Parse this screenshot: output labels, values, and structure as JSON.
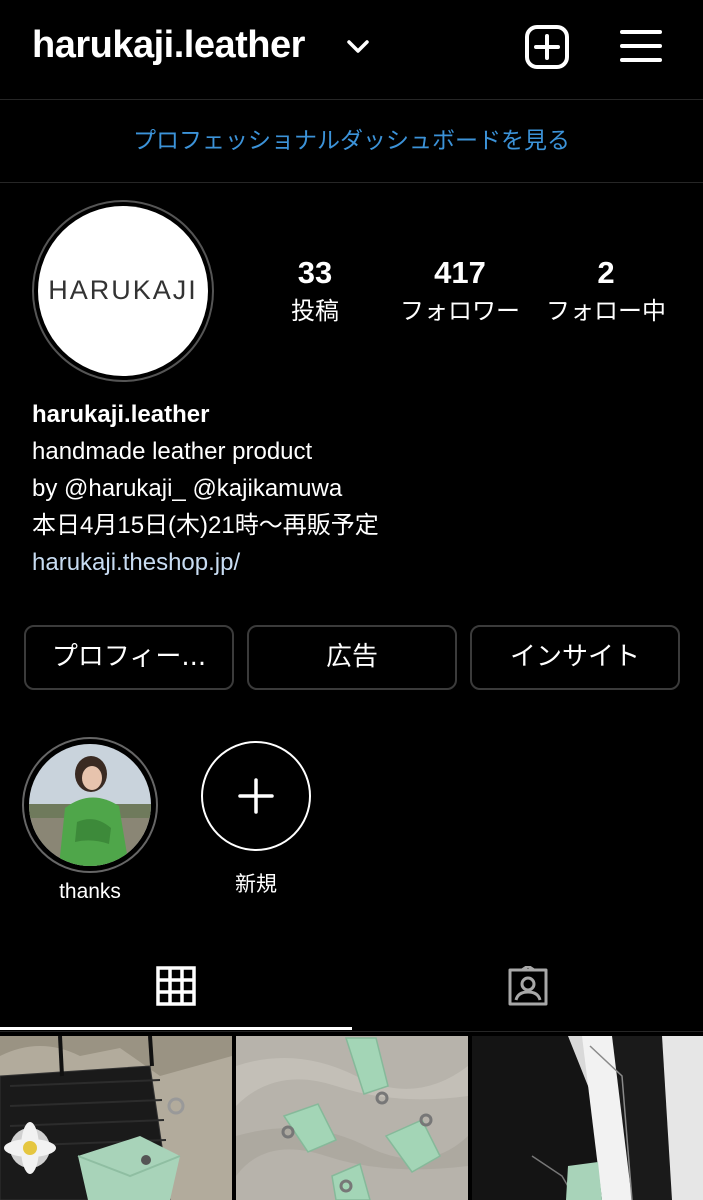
{
  "header": {
    "username": "harukaji.leather"
  },
  "dashboard_link": "プロフェッショナルダッシュボードを見る",
  "profile": {
    "avatar_text": "HARUKAJI",
    "stats": [
      {
        "number": "33",
        "label": "投稿"
      },
      {
        "number": "417",
        "label": "フォロワー"
      },
      {
        "number": "2",
        "label": "フォロー中"
      }
    ],
    "bio": {
      "name": "harukaji.leather",
      "line1": "handmade leather product",
      "line2": "by @harukaji_   @kajikamuwa",
      "line3": "本日4月15日(木)21時〜再販予定",
      "link": "harukaji.theshop.jp/"
    }
  },
  "buttons": {
    "edit_profile": "プロフィー...",
    "ads": "広告",
    "insights": "インサイト"
  },
  "highlights": [
    {
      "label": "thanks"
    },
    {
      "label": "新規"
    }
  ],
  "tabs": [
    "grid-tab",
    "tagged-tab"
  ],
  "colors": {
    "background": "#000000",
    "link_blue": "#3c93d9",
    "button_border": "#3b3b3b"
  }
}
